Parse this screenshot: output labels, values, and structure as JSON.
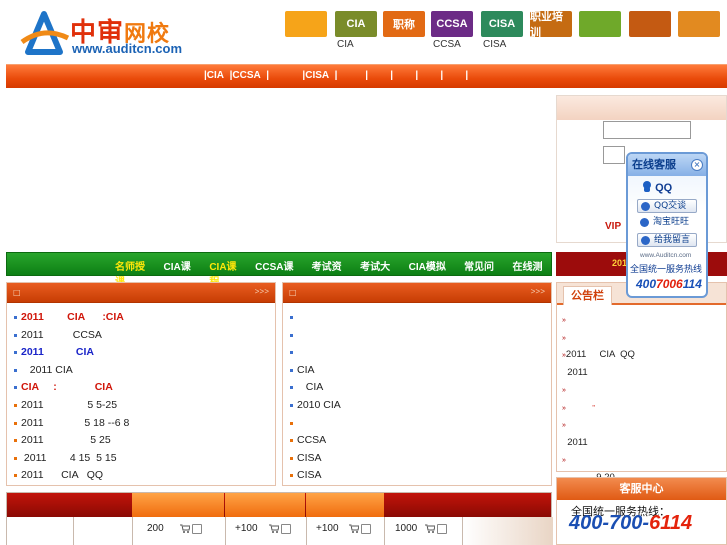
{
  "header": {
    "logo_cn_part1": "中审",
    "logo_cn_part2": "网校",
    "logo_url": "www.auditcn.com",
    "icons": [
      {
        "name": "home-icon",
        "label": "",
        "caption": "",
        "color": "#f6a419"
      },
      {
        "name": "cia-icon",
        "label": "CIA",
        "caption": "CIA",
        "color": "#7a8c2a"
      },
      {
        "name": "title-icon",
        "label": "职称",
        "caption": "",
        "color": "#e26a14"
      },
      {
        "name": "ccsa-icon",
        "label": "CCSA",
        "caption": "CCSA",
        "color": "#6c2b86"
      },
      {
        "name": "cisa-icon",
        "label": "CISA",
        "caption": "CISA",
        "color": "#2d8a5c"
      },
      {
        "name": "training-icon",
        "label": "职业培训",
        "caption": "",
        "color": "#c56b12"
      },
      {
        "name": "pencil-icon",
        "label": "",
        "caption": "",
        "color": "#6fa92a"
      },
      {
        "name": "book-icon",
        "label": "",
        "caption": "",
        "color": "#c45a12"
      },
      {
        "name": "cart-icon",
        "label": "",
        "caption": "",
        "color": "#e28a20"
      }
    ]
  },
  "mainnav": {
    "items": [
      "|CIA",
      "  |CCSA",
      "  |          ",
      "  |CISA",
      "  |        ",
      "  |      ",
      "  |      ",
      "  |      ",
      "  |      ",
      "  |"
    ]
  },
  "login": {
    "vip_label": "VIP"
  },
  "catbar": {
    "items": [
      {
        "label": "名师授课",
        "highlight": true
      },
      {
        "label": "CIA课程",
        "highlight": false
      },
      {
        "label": "CIA课程",
        "highlight": true
      },
      {
        "label": "CCSA课程",
        "highlight": false
      },
      {
        "label": "考试资讯",
        "highlight": false
      },
      {
        "label": "考试大纲",
        "highlight": false
      },
      {
        "label": "CIA模拟题",
        "highlight": false
      },
      {
        "label": "常见问题",
        "highlight": false
      },
      {
        "label": "在线测试",
        "highlight": false
      }
    ]
  },
  "redstrip": {
    "text": "201"
  },
  "left_panel": {
    "more": ">>>",
    "items": [
      {
        "text": "2011        CIA      :CIA",
        "style": "red"
      },
      {
        "text": "2011          CCSA",
        "style": ""
      },
      {
        "text": "2011           CIA",
        "style": "blue"
      },
      {
        "text": "   2011 CIA",
        "style": ""
      },
      {
        "text": "CIA     :             CIA",
        "style": "red"
      },
      {
        "text": "2011               5 5-25",
        "style": "orange"
      },
      {
        "text": "2011              5 18 --6 8",
        "style": "orange"
      },
      {
        "text": "2011                5 25",
        "style": "orange"
      },
      {
        "text": " 2011        4 15  5 15",
        "style": "orange"
      },
      {
        "text": "2011      CIA   QQ",
        "style": "orange"
      }
    ]
  },
  "right_panel": {
    "more": ">>>",
    "items": [
      {
        "text": "",
        "style": ""
      },
      {
        "text": "",
        "style": ""
      },
      {
        "text": "",
        "style": ""
      },
      {
        "text": "CIA",
        "style": ""
      },
      {
        "text": "   CIA",
        "style": ""
      },
      {
        "text": "2010 CIA",
        "style": ""
      },
      {
        "text": "",
        "style": "orange"
      },
      {
        "text": "CCSA",
        "style": "orange"
      },
      {
        "text": "CISA",
        "style": "orange"
      },
      {
        "text": "CISA",
        "style": "orange"
      }
    ]
  },
  "notice": {
    "tab": "公告栏",
    "items": [
      {
        "text": "",
        "arrow": "»"
      },
      {
        "text": "",
        "arrow": "»"
      },
      {
        "text": "2011     CIA  QQ",
        "arrow": "»"
      },
      {
        "text": "  2011",
        "arrow": ""
      },
      {
        "text": "",
        "arrow": "»"
      },
      {
        "text": "          ",
        "arrow": "»",
        "mark": "\""
      },
      {
        "text": "",
        "arrow": "»"
      },
      {
        "text": "  2011",
        "arrow": ""
      },
      {
        "text": "",
        "arrow": "»"
      },
      {
        "text": "             9.20",
        "arrow": ""
      }
    ]
  },
  "floatcs": {
    "title": "在线客服",
    "close": "×",
    "qq_label": "QQ",
    "btn_qq": "QQ交谈",
    "btn_taobao": "淘宝旺旺",
    "btn_msg": "给我留言",
    "url": "www.Auditcn.com",
    "hotline_label": "全国统一服务热线",
    "phone_part1": "400",
    "phone_part2": "7006",
    "phone_part3": "114"
  },
  "pricetable": {
    "values": [
      "200",
      "+100",
      "+100",
      "1000"
    ]
  },
  "service": {
    "title": "客服中心",
    "hotline_label": "全国统一服务热线：",
    "phone_a": "400-700-",
    "phone_b": "6114"
  }
}
